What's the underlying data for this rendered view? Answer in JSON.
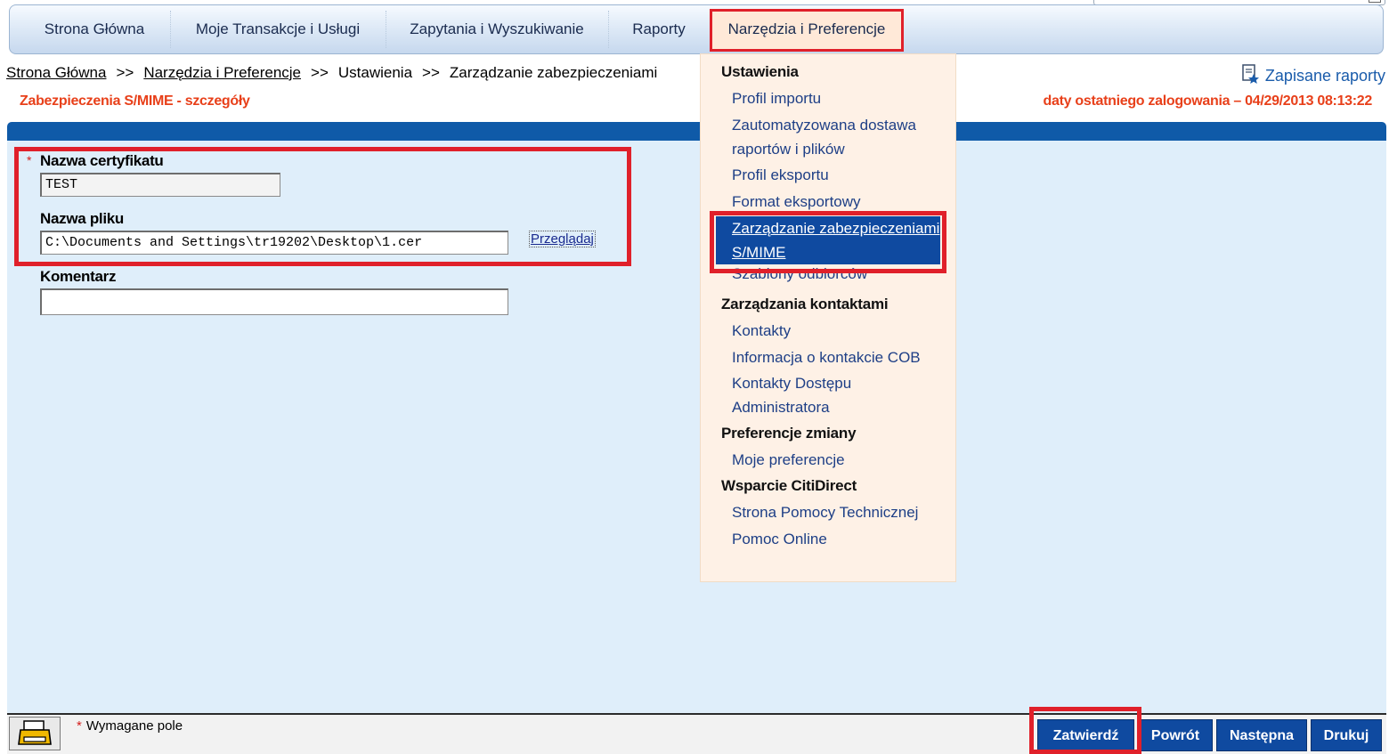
{
  "nav": {
    "items": [
      {
        "label": "Strona Główna"
      },
      {
        "label": "Moje Transakcje i Usługi"
      },
      {
        "label": "Zapytania i Wyszukiwanie"
      },
      {
        "label": "Raporty"
      },
      {
        "label": "Narzędzia i Preferencje"
      }
    ]
  },
  "breadcrumb": {
    "home": "Strona Główna",
    "sep": ">>",
    "tools": "Narzędzia i Preferencje",
    "settings": "Ustawienia",
    "current": "Zarządzanie zabezpieczeniami"
  },
  "saved_reports": "Zapisane raporty",
  "page_title": "Zabezpieczenia S/MIME - szczegóły",
  "last_login": "daty ostatniego zalogowania – 04/29/2013 08:13:22",
  "form": {
    "required_marker": "*",
    "cert_name_label": "Nazwa certyfikatu",
    "cert_name_value": "TEST",
    "file_name_label": "Nazwa pliku",
    "file_name_value": "C:\\Documents and Settings\\tr19202\\Desktop\\1.cer",
    "browse_label": "Przeglądaj",
    "comment_label": "Komentarz",
    "comment_value": ""
  },
  "menu": {
    "settings_header": "Ustawienia",
    "settings_items": [
      "Profil importu",
      "Zautomatyzowana dostawa raportów i plików",
      "Profil eksportu",
      "Format eksportowy",
      "Zarządzanie zabezpieczeniami S/MIME",
      "Szablony odbiorców"
    ],
    "contacts_header": "Zarządzania kontaktami",
    "contacts_items": [
      "Kontakty",
      "Informacja o kontakcie COB",
      "Kontakty Dostępu Administratora"
    ],
    "prefs_header": "Preferencje zmiany",
    "prefs_items": [
      "Moje preferencje"
    ],
    "support_header": "Wsparcie CitiDirect",
    "support_items": [
      "Strona Pomocy Technicznej",
      "Pomoc Online"
    ]
  },
  "footer": {
    "required_star": "*",
    "required_note": "Wymagane pole",
    "buttons": {
      "submit": "Zatwierdź",
      "back": "Powrót",
      "next": "Następna",
      "print": "Drukuj"
    }
  },
  "colors": {
    "accent_orange": "#e8401a",
    "primary_blue": "#0f4aa0",
    "highlight_red": "#e0202a",
    "menu_bg": "#fef1e6",
    "panel_bg": "#dfeefa"
  }
}
